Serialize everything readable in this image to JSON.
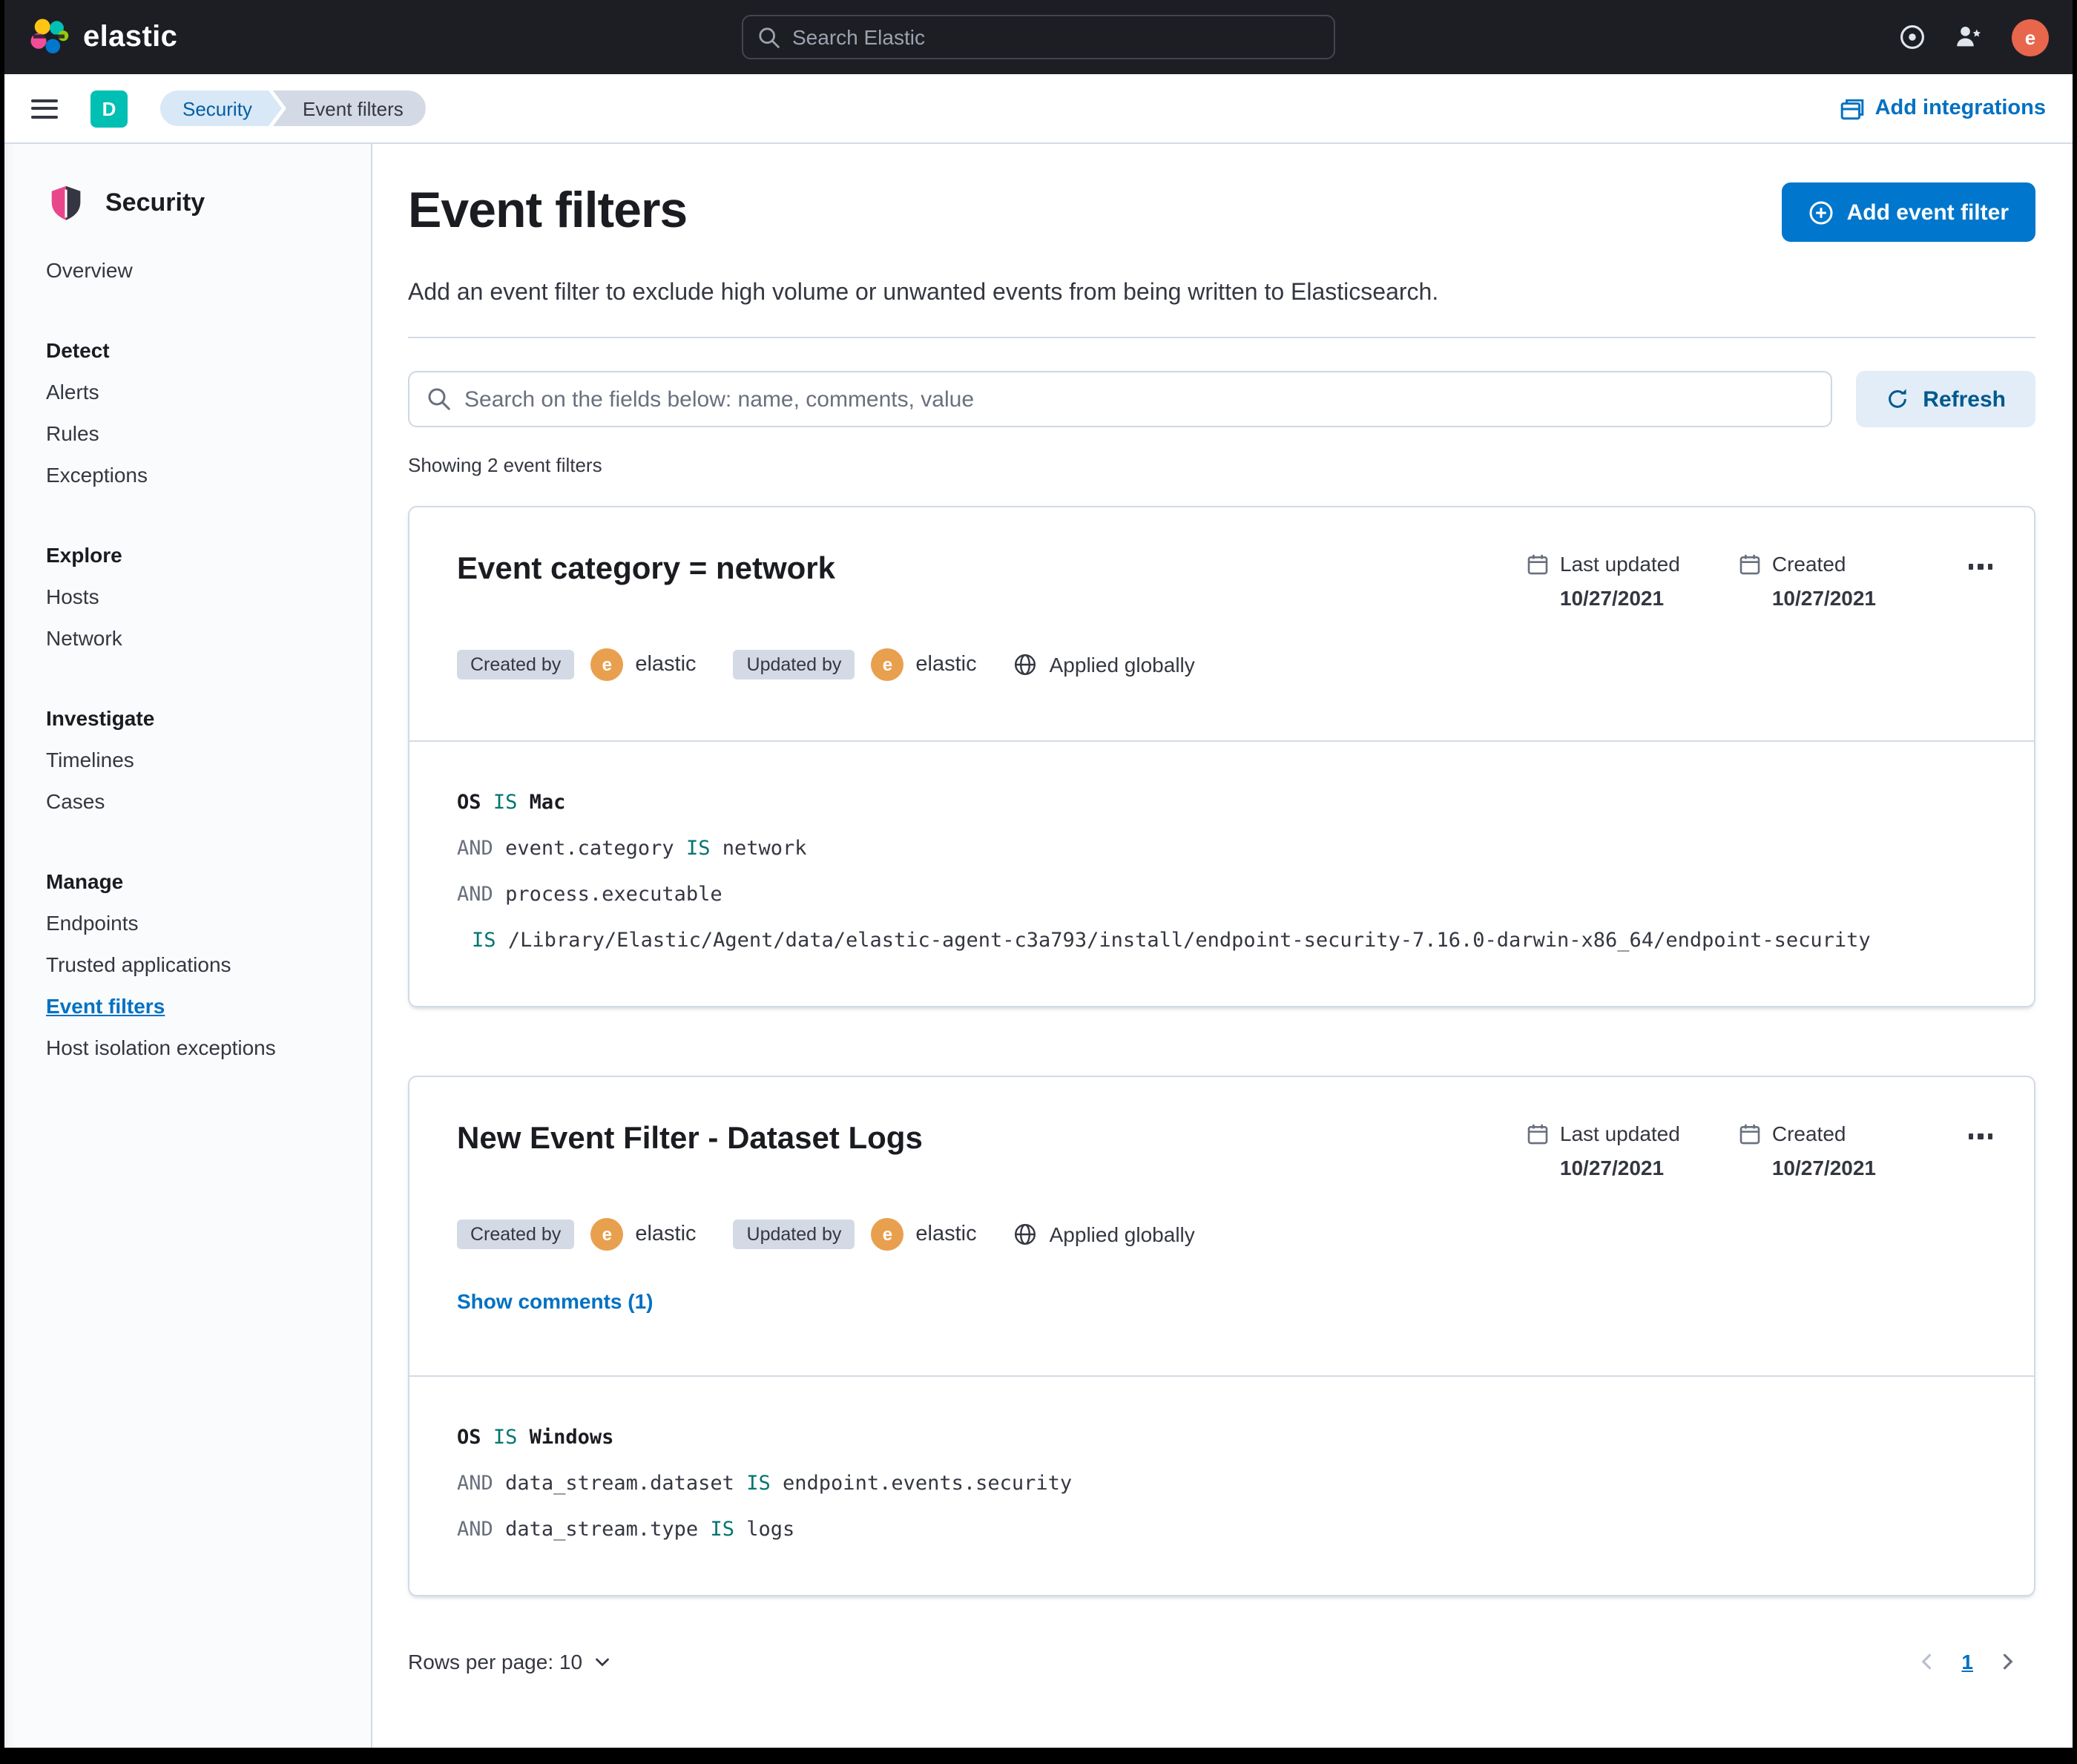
{
  "header": {
    "brand": "elastic",
    "search_placeholder": "Search Elastic",
    "user_initial": "e"
  },
  "nav_bar": {
    "space_initial": "D",
    "breadcrumbs": [
      {
        "label": "Security"
      },
      {
        "label": "Event filters"
      }
    ],
    "add_integrations_label": "Add integrations"
  },
  "sidebar": {
    "title": "Security",
    "sections": [
      {
        "heading": "",
        "items": [
          {
            "label": "Overview",
            "active": false
          }
        ]
      },
      {
        "heading": "Detect",
        "items": [
          {
            "label": "Alerts",
            "active": false
          },
          {
            "label": "Rules",
            "active": false
          },
          {
            "label": "Exceptions",
            "active": false
          }
        ]
      },
      {
        "heading": "Explore",
        "items": [
          {
            "label": "Hosts",
            "active": false
          },
          {
            "label": "Network",
            "active": false
          }
        ]
      },
      {
        "heading": "Investigate",
        "items": [
          {
            "label": "Timelines",
            "active": false
          },
          {
            "label": "Cases",
            "active": false
          }
        ]
      },
      {
        "heading": "Manage",
        "items": [
          {
            "label": "Endpoints",
            "active": false
          },
          {
            "label": "Trusted applications",
            "active": false
          },
          {
            "label": "Event filters",
            "active": true
          },
          {
            "label": "Host isolation exceptions",
            "active": false
          }
        ]
      }
    ]
  },
  "main": {
    "title": "Event filters",
    "add_button_label": "Add event filter",
    "description": "Add an event filter to exclude high volume or unwanted events from being written to Elasticsearch.",
    "search_placeholder": "Search on the fields below: name, comments, value",
    "refresh_label": "Refresh",
    "results_summary": "Showing 2 event filters"
  },
  "filters": [
    {
      "title": "Event category = network",
      "last_updated_label": "Last updated",
      "last_updated_date": "10/27/2021",
      "created_label": "Created",
      "created_date": "10/27/2021",
      "created_by_label": "Created by",
      "created_by_user": "elastic",
      "updated_by_label": "Updated by",
      "updated_by_user": "elastic",
      "scope_label": "Applied globally",
      "comments_link": null,
      "code_lines": [
        {
          "indent": false,
          "segments": [
            {
              "text": "OS",
              "type": "kw"
            },
            {
              "text": "IS",
              "type": "op"
            },
            {
              "text": "Mac",
              "type": "kw"
            }
          ]
        },
        {
          "indent": false,
          "segments": [
            {
              "text": "AND",
              "type": "and"
            },
            {
              "text": "event.category",
              "type": "plain"
            },
            {
              "text": "IS",
              "type": "op"
            },
            {
              "text": "network",
              "type": "plain"
            }
          ]
        },
        {
          "indent": false,
          "segments": [
            {
              "text": "AND",
              "type": "and"
            },
            {
              "text": "process.executable",
              "type": "plain"
            }
          ]
        },
        {
          "indent": true,
          "segments": [
            {
              "text": "IS",
              "type": "op"
            },
            {
              "text": "/Library/Elastic/Agent/data/elastic-agent-c3a793/install/endpoint-security-7.16.0-darwin-x86_64/endpoint-security",
              "type": "plain"
            }
          ]
        }
      ]
    },
    {
      "title": "New Event Filter - Dataset Logs",
      "last_updated_label": "Last updated",
      "last_updated_date": "10/27/2021",
      "created_label": "Created",
      "created_date": "10/27/2021",
      "created_by_label": "Created by",
      "created_by_user": "elastic",
      "updated_by_label": "Updated by",
      "updated_by_user": "elastic",
      "scope_label": "Applied globally",
      "comments_link": "Show comments (1)",
      "code_lines": [
        {
          "indent": false,
          "segments": [
            {
              "text": "OS",
              "type": "kw"
            },
            {
              "text": "IS",
              "type": "op"
            },
            {
              "text": "Windows",
              "type": "kw"
            }
          ]
        },
        {
          "indent": false,
          "segments": [
            {
              "text": "AND",
              "type": "and"
            },
            {
              "text": "data_stream.dataset",
              "type": "plain"
            },
            {
              "text": "IS",
              "type": "op"
            },
            {
              "text": "endpoint.events.security",
              "type": "plain"
            }
          ]
        },
        {
          "indent": false,
          "segments": [
            {
              "text": "AND",
              "type": "and"
            },
            {
              "text": "data_stream.type",
              "type": "plain"
            },
            {
              "text": "IS",
              "type": "op"
            },
            {
              "text": "logs",
              "type": "plain"
            }
          ]
        }
      ]
    }
  ],
  "footer": {
    "rows_per_page_label": "Rows per page: 10",
    "page_number": "1"
  },
  "icons": {
    "search": "magnifier",
    "calendar": "calendar-grid",
    "globe": "globe-meridians",
    "actions": "horizontal-dots",
    "add": "plus-circle",
    "refresh": "circular-arrow"
  },
  "colors": {
    "primary": "#0077cc",
    "header_bg": "#1d1e24",
    "accent_teal": "#00bfb3",
    "avatar_orange": "#e8a04f",
    "avatar_red": "#e7664c",
    "operator_teal": "#00756f",
    "border": "#d3dae6"
  }
}
